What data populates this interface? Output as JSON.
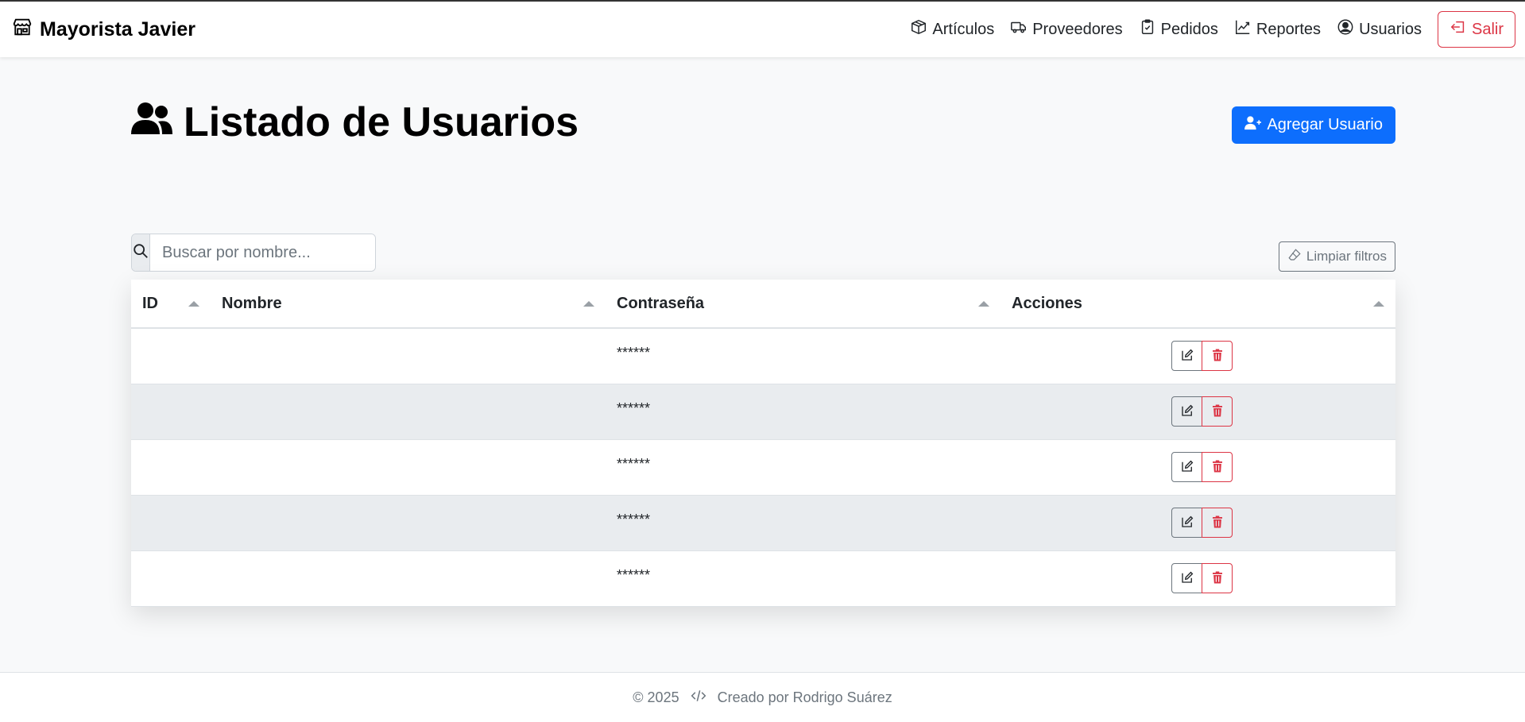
{
  "navbar": {
    "brand": "Mayorista Javier",
    "links": [
      {
        "label": "Artículos",
        "icon": "box-icon"
      },
      {
        "label": "Proveedores",
        "icon": "truck-icon"
      },
      {
        "label": "Pedidos",
        "icon": "clipboard-check-icon"
      },
      {
        "label": "Reportes",
        "icon": "graph-up-icon"
      },
      {
        "label": "Usuarios",
        "icon": "person-circle-icon"
      }
    ],
    "logout_label": "Salir"
  },
  "page": {
    "title": "Listado de Usuarios",
    "add_button_label": "Agregar Usuario"
  },
  "filters": {
    "search_placeholder": "Buscar por nombre...",
    "search_value": "",
    "clear_label": "Limpiar filtros"
  },
  "table": {
    "columns": [
      "ID",
      "Nombre",
      "Contraseña",
      "Acciones"
    ],
    "rows": [
      {
        "id": "",
        "nombre": "",
        "password": "******"
      },
      {
        "id": "",
        "nombre": "",
        "password": "******"
      },
      {
        "id": "",
        "nombre": "",
        "password": "******"
      },
      {
        "id": "",
        "nombre": "",
        "password": "******"
      },
      {
        "id": "",
        "nombre": "",
        "password": "******"
      }
    ]
  },
  "footer": {
    "copyright": "© 2025",
    "credit": "Creado por Rodrigo Suárez"
  },
  "colors": {
    "primary": "#0d6efd",
    "danger": "#dc3545",
    "secondary": "#6c757d",
    "background": "#f8f9fa",
    "stripe": "#e9ecef"
  }
}
